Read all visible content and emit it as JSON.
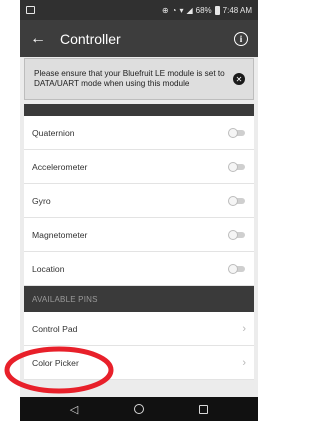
{
  "status_bar": {
    "icons": [
      "notification-icon",
      "data-sync-icon",
      "alarm-icon",
      "wifi-icon",
      "signal-icon",
      "battery-icon"
    ],
    "battery": "68%",
    "time": "7:48 AM"
  },
  "app_bar": {
    "title": "Controller",
    "back_icon": "arrow-back-icon",
    "info_icon": "info-icon"
  },
  "banner": {
    "message": "Please ensure that your Bluefruit LE module is set to DATA/UART mode when using this module",
    "close_icon": "close-icon"
  },
  "sensors": [
    {
      "label": "Quaternion",
      "enabled": false
    },
    {
      "label": "Accelerometer",
      "enabled": false
    },
    {
      "label": "Gyro",
      "enabled": false
    },
    {
      "label": "Magnetometer",
      "enabled": false
    },
    {
      "label": "Location",
      "enabled": false
    }
  ],
  "available_pins": {
    "header": "AVAILABLE PINS",
    "items": [
      {
        "label": "Control Pad"
      },
      {
        "label": "Color Picker"
      }
    ]
  },
  "annotation": {
    "color": "#e8202a",
    "target": "Color Picker"
  },
  "colors": {
    "app_bar": "#3d3d3d",
    "status_bar": "#303030",
    "section_header": "#3a3a3a",
    "nav_bar": "#111111"
  }
}
